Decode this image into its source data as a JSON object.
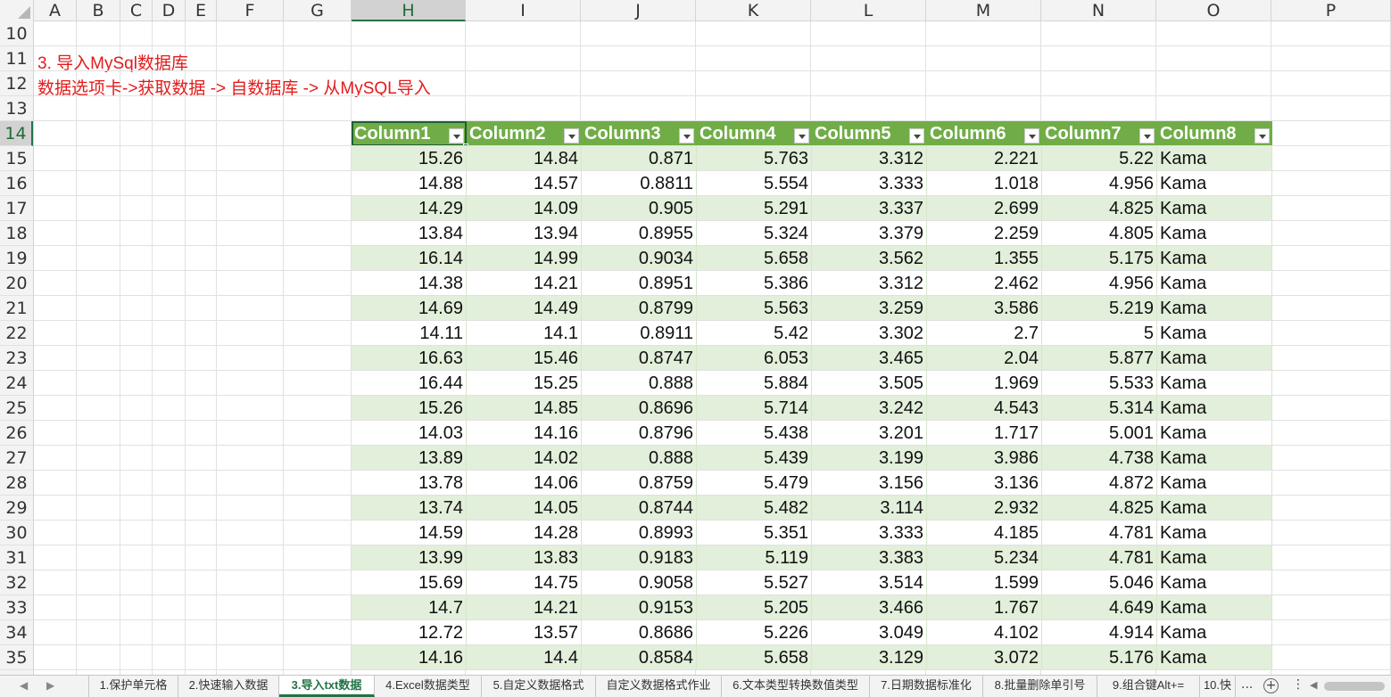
{
  "column_headers": [
    "A",
    "B",
    "C",
    "D",
    "E",
    "F",
    "G",
    "H",
    "I",
    "J",
    "K",
    "L",
    "M",
    "N",
    "O",
    "P"
  ],
  "selected_column": "H",
  "row_numbers": [
    10,
    11,
    12,
    13,
    14,
    15,
    16,
    17,
    18,
    19,
    20,
    21,
    22,
    23,
    24,
    25,
    26,
    27,
    28,
    29,
    30,
    31,
    32,
    33,
    34,
    35
  ],
  "selected_row": 14,
  "notes": {
    "title": "3. 导入MySql数据库",
    "steps": "数据选项卡->获取数据 -> 自数据库 -> 从MySQL导入"
  },
  "table": {
    "headers": [
      "Column1",
      "Column2",
      "Column3",
      "Column4",
      "Column5",
      "Column6",
      "Column7",
      "Column8"
    ],
    "rows": [
      [
        "15.26",
        "14.84",
        "0.871",
        "5.763",
        "3.312",
        "2.221",
        "5.22",
        "Kama"
      ],
      [
        "14.88",
        "14.57",
        "0.8811",
        "5.554",
        "3.333",
        "1.018",
        "4.956",
        "Kama"
      ],
      [
        "14.29",
        "14.09",
        "0.905",
        "5.291",
        "3.337",
        "2.699",
        "4.825",
        "Kama"
      ],
      [
        "13.84",
        "13.94",
        "0.8955",
        "5.324",
        "3.379",
        "2.259",
        "4.805",
        "Kama"
      ],
      [
        "16.14",
        "14.99",
        "0.9034",
        "5.658",
        "3.562",
        "1.355",
        "5.175",
        "Kama"
      ],
      [
        "14.38",
        "14.21",
        "0.8951",
        "5.386",
        "3.312",
        "2.462",
        "4.956",
        "Kama"
      ],
      [
        "14.69",
        "14.49",
        "0.8799",
        "5.563",
        "3.259",
        "3.586",
        "5.219",
        "Kama"
      ],
      [
        "14.11",
        "14.1",
        "0.8911",
        "5.42",
        "3.302",
        "2.7",
        "5",
        "Kama"
      ],
      [
        "16.63",
        "15.46",
        "0.8747",
        "6.053",
        "3.465",
        "2.04",
        "5.877",
        "Kama"
      ],
      [
        "16.44",
        "15.25",
        "0.888",
        "5.884",
        "3.505",
        "1.969",
        "5.533",
        "Kama"
      ],
      [
        "15.26",
        "14.85",
        "0.8696",
        "5.714",
        "3.242",
        "4.543",
        "5.314",
        "Kama"
      ],
      [
        "14.03",
        "14.16",
        "0.8796",
        "5.438",
        "3.201",
        "1.717",
        "5.001",
        "Kama"
      ],
      [
        "13.89",
        "14.02",
        "0.888",
        "5.439",
        "3.199",
        "3.986",
        "4.738",
        "Kama"
      ],
      [
        "13.78",
        "14.06",
        "0.8759",
        "5.479",
        "3.156",
        "3.136",
        "4.872",
        "Kama"
      ],
      [
        "13.74",
        "14.05",
        "0.8744",
        "5.482",
        "3.114",
        "2.932",
        "4.825",
        "Kama"
      ],
      [
        "14.59",
        "14.28",
        "0.8993",
        "5.351",
        "3.333",
        "4.185",
        "4.781",
        "Kama"
      ],
      [
        "13.99",
        "13.83",
        "0.9183",
        "5.119",
        "3.383",
        "5.234",
        "4.781",
        "Kama"
      ],
      [
        "15.69",
        "14.75",
        "0.9058",
        "5.527",
        "3.514",
        "1.599",
        "5.046",
        "Kama"
      ],
      [
        "14.7",
        "14.21",
        "0.9153",
        "5.205",
        "3.466",
        "1.767",
        "4.649",
        "Kama"
      ],
      [
        "12.72",
        "13.57",
        "0.8686",
        "5.226",
        "3.049",
        "4.102",
        "4.914",
        "Kama"
      ],
      [
        "14.16",
        "14.4",
        "0.8584",
        "5.658",
        "3.129",
        "3.072",
        "5.176",
        "Kama"
      ]
    ]
  },
  "sheet_tabs": [
    "1.保护单元格",
    "2.快速输入数据",
    "3.导入txt数据",
    "4.Excel数据类型",
    "5.自定义数据格式",
    "自定义数据格式作业",
    "6.文本类型转换数值类型",
    "7.日期数据标准化",
    "8.批量删除单引号",
    "9.组合键Alt+=",
    "10.快"
  ],
  "active_sheet_tab": "3.导入txt数据",
  "tab_overflow": "...",
  "colors": {
    "table_header": "#70ad47",
    "band_row": "#e2efda",
    "note_text": "#e21c1c",
    "excel_green": "#217346"
  }
}
